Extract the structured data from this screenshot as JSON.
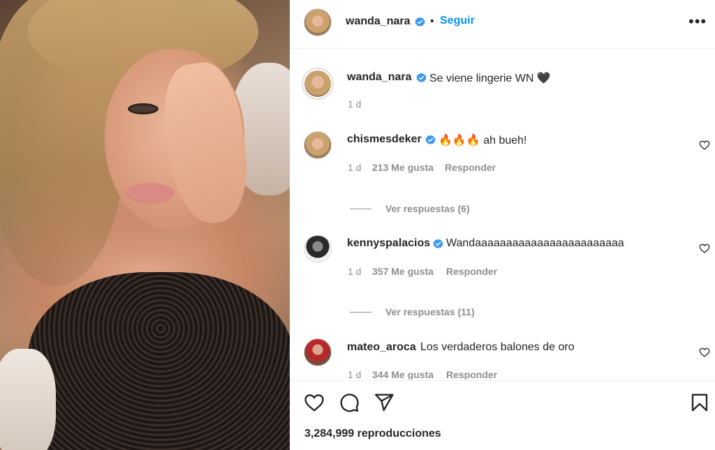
{
  "post": {
    "username": "wanda_nara",
    "follow_label": "Seguir",
    "more_label": "•••",
    "caption": "Se viene lingerie WN 🖤",
    "caption_age": "1 d"
  },
  "comments": [
    {
      "username": "chismesdeker",
      "verified": true,
      "text": "🔥🔥🔥 ah bueh!",
      "age": "1 d",
      "likes": "213 Me gusta",
      "reply_label": "Responder",
      "view_replies": "Ver respuestas (6)"
    },
    {
      "username": "kennyspalacios",
      "verified": true,
      "text": "Wandaaaaaaaaaaaaaaaaaaaaaaaa",
      "age": "1 d",
      "likes": "357 Me gusta",
      "reply_label": "Responder",
      "view_replies": "Ver respuestas (11)"
    },
    {
      "username": "mateo_aroca",
      "verified": false,
      "text": "Los verdaderos balones de oro",
      "age": "1 d",
      "likes": "344 Me gusta",
      "reply_label": "Responder"
    }
  ],
  "footer": {
    "views_count": "3,284,999",
    "views_label": "reproducciones"
  },
  "icons": {
    "verified": "verified-badge-icon",
    "like": "heart-icon",
    "comment": "comment-bubble-icon",
    "share": "paper-plane-icon",
    "save": "bookmark-icon"
  },
  "colors": {
    "accent": "#0095f6",
    "text": "#262626",
    "muted": "#8e8e8e",
    "verified": "#3897f0"
  }
}
